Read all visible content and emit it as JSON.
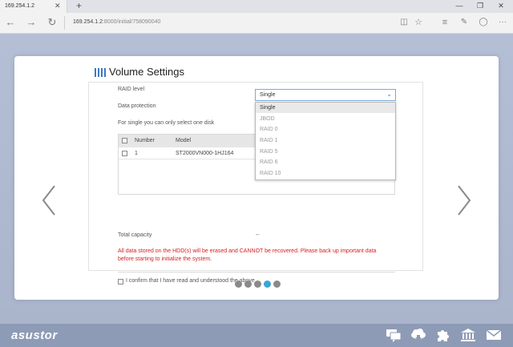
{
  "browser": {
    "tab_title": "169.254.1.2",
    "tab_close": "✕",
    "new_tab": "+",
    "url_host": "169.254.1.2",
    "url_rest": ":8000/initial/758090040",
    "window_controls": [
      "—",
      "❐",
      "✕"
    ]
  },
  "page": {
    "title": "Volume Settings",
    "raid_label": "RAID level",
    "raid_value": "Single",
    "data_protection_label": "Data protection",
    "hint": "For single you can only select one disk",
    "table": {
      "headers": [
        "Number",
        "Model"
      ],
      "rows": [
        {
          "number": "1",
          "model": "ST2000VN000-1HJ164"
        }
      ]
    },
    "total_capacity_label": "Total capacity",
    "total_capacity_value": "--",
    "warning": "All data stored on the HDD(s) will be erased and CANNOT be recovered. Please back up important data before starting to initialize the system.",
    "confirm_label": "I confirm that I have read and understood the above"
  },
  "dropdown": {
    "options": [
      "Single",
      "JBOD",
      "RAID 0",
      "RAID 1",
      "RAID 5",
      "RAID 6",
      "RAID 10"
    ],
    "selected_index": 0
  },
  "pagination": {
    "total": 5,
    "active_index": 3
  },
  "footer": {
    "logo": "asustor",
    "icons": [
      "chat-icon",
      "cloud-download-icon",
      "puzzle-icon",
      "institution-icon",
      "mail-icon"
    ]
  },
  "colors": {
    "accent": "#3c79c6",
    "warning": "#d62020",
    "active_dot": "#39a6d4",
    "footer_bg": "#8e9bb6"
  }
}
